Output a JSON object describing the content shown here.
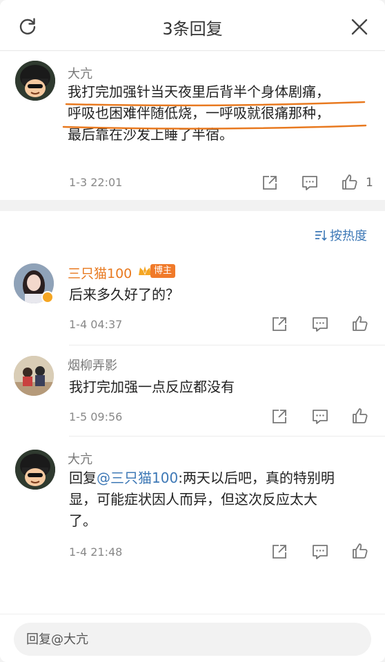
{
  "header": {
    "title": "3条回复"
  },
  "root_comment": {
    "user": "大亢",
    "lines": [
      "我打完加强针当天夜里后背半个身体剧痛，",
      "呼吸也困难伴随低烧，一呼吸就很痛那种，",
      "最后靠在沙发上睡了半宿。"
    ],
    "time": "1-3 22:01",
    "like_count": "1"
  },
  "sort": {
    "label": "按热度"
  },
  "replies": [
    {
      "user": "三只猫100",
      "badge": "博主",
      "text": "后来多久好了的？",
      "time": "1-4 04:37"
    },
    {
      "user": "烟柳弄影",
      "text": "我打完加强一点反应都没有",
      "time": "1-5 09:56"
    },
    {
      "user": "大亢",
      "prefix": "回复",
      "mention": "@三只猫100",
      "line1_rest": ":两天以后吧，真的特别明",
      "line2": "显，可能症状因人而异，但这次反应太大",
      "line3": "了。",
      "time": "1-4 21:48"
    }
  ],
  "footer": {
    "placeholder": "回复@大亢"
  },
  "colors": {
    "accent": "#3d78b6",
    "highlight_user": "#e8791f",
    "underline": "#e8791f"
  }
}
